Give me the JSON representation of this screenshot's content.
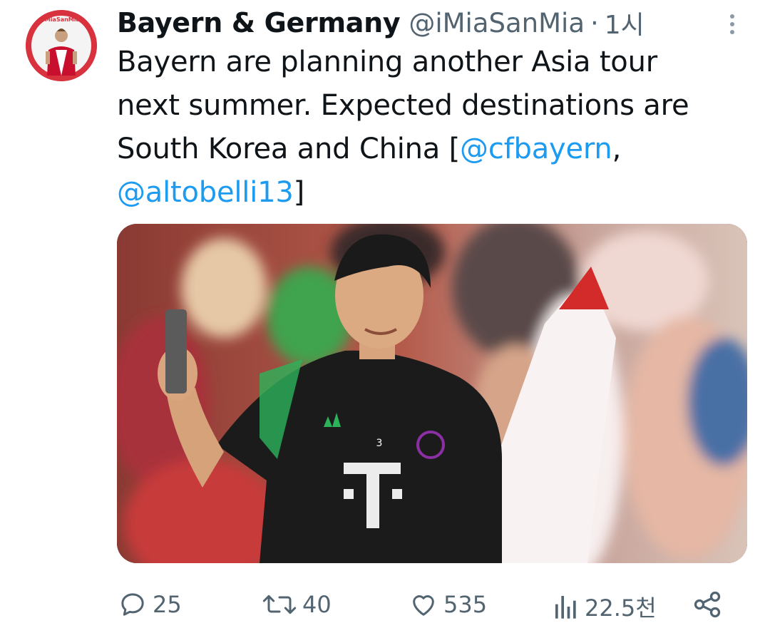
{
  "author": {
    "display_name": "Bayern & Germany",
    "handle": "@iMiaSanMia",
    "separator": "·",
    "time": "1시",
    "avatar_icon": "profile-photo-avatar"
  },
  "tweet": {
    "line1": "Bayern are planning another Asia tour",
    "line2": "next summer. Expected destinations are",
    "line3_text": "South Korea and China [",
    "mention1": "@cfbayern",
    "line3_suffix": ",",
    "mention2": "@altobelli13",
    "line4_suffix": "]"
  },
  "media": {
    "description_icon": "photo-player-selfie-with-fans",
    "jersey_number": "3"
  },
  "actions": {
    "reply_count": "25",
    "retweet_count": "40",
    "like_count": "535",
    "views_count": "22.5천"
  },
  "colors": {
    "text": "#0f1419",
    "secondary": "#536471",
    "link": "#1d9bf0"
  }
}
